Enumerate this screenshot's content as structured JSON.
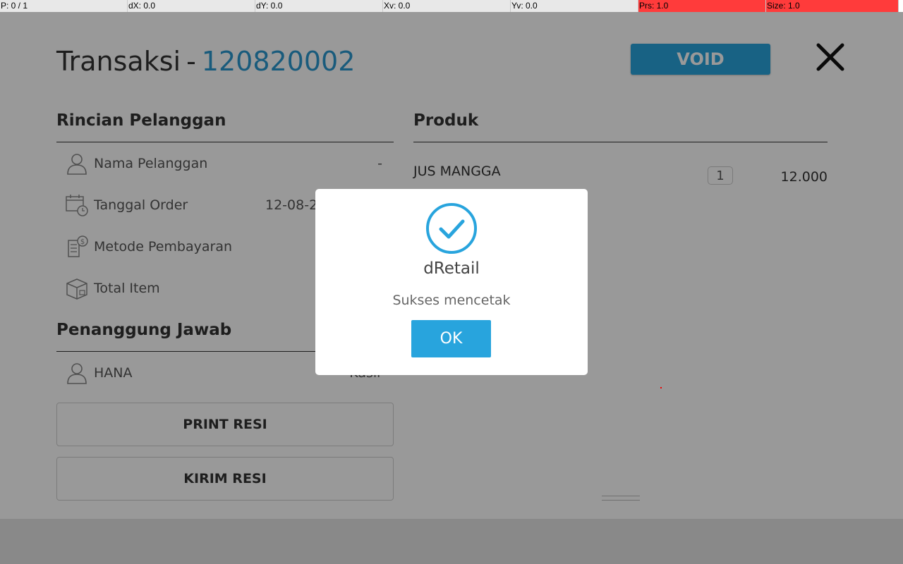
{
  "statusbar": {
    "p": "P: 0 / 1",
    "dx": "dX: 0.0",
    "dy": "dY: 0.0",
    "xv": "Xv: 0.0",
    "yv": "Yv: 0.0",
    "prs": "Prs: 1.0",
    "size": "Size: 1.0",
    "highlight_color": "#ff3b3b"
  },
  "header": {
    "title": "Transaksi",
    "separator": "-",
    "transaction_id": "120820002",
    "void_label": "VOID",
    "close_icon": "close-icon"
  },
  "customer": {
    "section_title": "Rincian Pelanggan",
    "rows": [
      {
        "icon": "user-icon",
        "label": "Nama Pelanggan",
        "value": "-"
      },
      {
        "icon": "calendar-clock-icon",
        "label": "Tanggal Order",
        "value": "12-08-2"
      },
      {
        "icon": "receipt-dollar-icon",
        "label": "Metode Pembayaran",
        "value": ""
      },
      {
        "icon": "box-icon",
        "label": "Total Item",
        "value": ""
      }
    ]
  },
  "responsible": {
    "section_title": "Penanggung Jawab",
    "name": "HANA",
    "role": "Kasir",
    "icon": "user-icon"
  },
  "actions": {
    "print_label": "PRINT RESI",
    "send_label": "KIRIM RESI"
  },
  "products": {
    "section_title": "Produk",
    "items": [
      {
        "name": "JUS MANGGA",
        "qty": "1",
        "price": "12.000"
      }
    ]
  },
  "dialog": {
    "icon": "check-circle-icon",
    "title": "dRetail",
    "message": "Sukses mencetak",
    "ok_label": "OK",
    "accent_color": "#28a4dd"
  }
}
